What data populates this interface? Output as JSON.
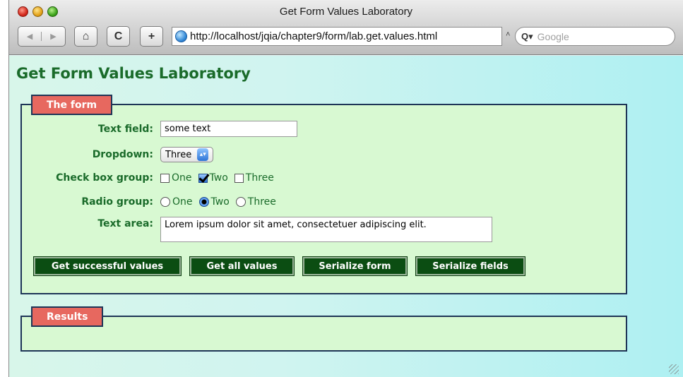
{
  "window": {
    "title": "Get Form Values Laboratory"
  },
  "toolbar": {
    "back_icon": "◀",
    "forward_icon": "▶",
    "home_icon": "⌂",
    "reload_icon": "C",
    "add_icon": "+",
    "url": "http://localhost/jqia/chapter9/form/lab.get.values.html",
    "url_dropdown_icon": "˄",
    "search_placeholder": "Google",
    "search_icon": "Q▾"
  },
  "page": {
    "heading": "Get Form Values Laboratory",
    "form": {
      "legend": "The form",
      "text_field": {
        "label": "Text field:",
        "value": "some text"
      },
      "dropdown": {
        "label": "Dropdown:",
        "selected": "Three",
        "arrow": "▴▾"
      },
      "checkbox_group": {
        "label": "Check box group:",
        "options": [
          {
            "label": "One",
            "checked": false
          },
          {
            "label": "Two",
            "checked": true
          },
          {
            "label": "Three",
            "checked": false
          }
        ]
      },
      "radio_group": {
        "label": "Radio group:",
        "options": [
          {
            "label": "One",
            "selected": false
          },
          {
            "label": "Two",
            "selected": true
          },
          {
            "label": "Three",
            "selected": false
          }
        ]
      },
      "text_area": {
        "label": "Text area:",
        "value": "Lorem ipsum dolor sit amet, consectetuer adipiscing elit."
      },
      "buttons": {
        "successful": "Get successful values",
        "all": "Get all values",
        "serialize_form": "Serialize form",
        "serialize_fields": "Serialize fields"
      }
    },
    "results": {
      "legend": "Results"
    }
  },
  "colors": {
    "heading": "#1a6b2a",
    "legend_bg": "#e7685f",
    "fieldset_bg": "#d8f9d2",
    "button_bg": "#0b4d12"
  }
}
